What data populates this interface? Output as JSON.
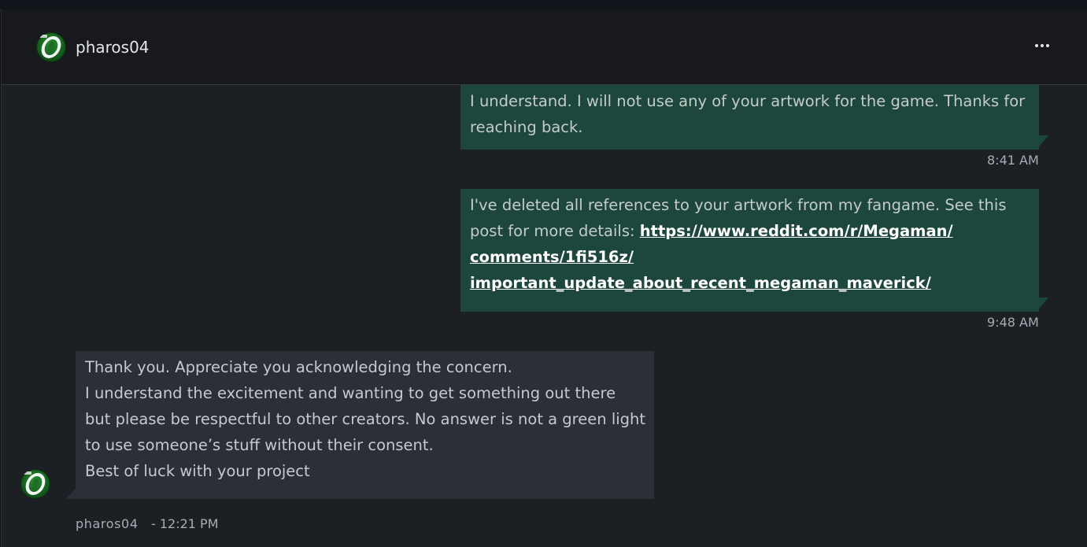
{
  "conversation": {
    "contact_name": "pharos04",
    "avatar_icon": "green-o-logo-avatar",
    "more_icon": "more-horizontal-icon"
  },
  "messages": [
    {
      "direction": "outgoing",
      "lines": [
        "I understand. I will not use any of your artwork for the game. Thanks for",
        "reaching back."
      ],
      "time": "8:41 AM"
    },
    {
      "direction": "outgoing",
      "lines": [
        "I've deleted all references to your artwork from my fangame. See this"
      ],
      "line2_prefix": "post for more details: ",
      "link_lines": [
        "https://www.reddit.com/r/Megaman/",
        "comments/1fi516z/",
        "important_update_about_recent_megaman_maverick/"
      ],
      "time": "9:48 AM"
    },
    {
      "direction": "incoming",
      "lines": [
        "Thank you. Appreciate you acknowledging the concern.",
        "I understand the excitement and wanting to get something out there",
        "but please be respectful to other creators. No answer is not a green light",
        "to use someone’s stuff without their consent.",
        "Best of luck with your project"
      ],
      "sender": "pharos04",
      "time": "- 12:21 PM"
    }
  ],
  "colors": {
    "outgoing_bubble": "#1d473d",
    "incoming_bubble": "#2b2f36",
    "panel_background": "#1c1f24",
    "header_background": "#17191d",
    "link": "#ffffff"
  }
}
